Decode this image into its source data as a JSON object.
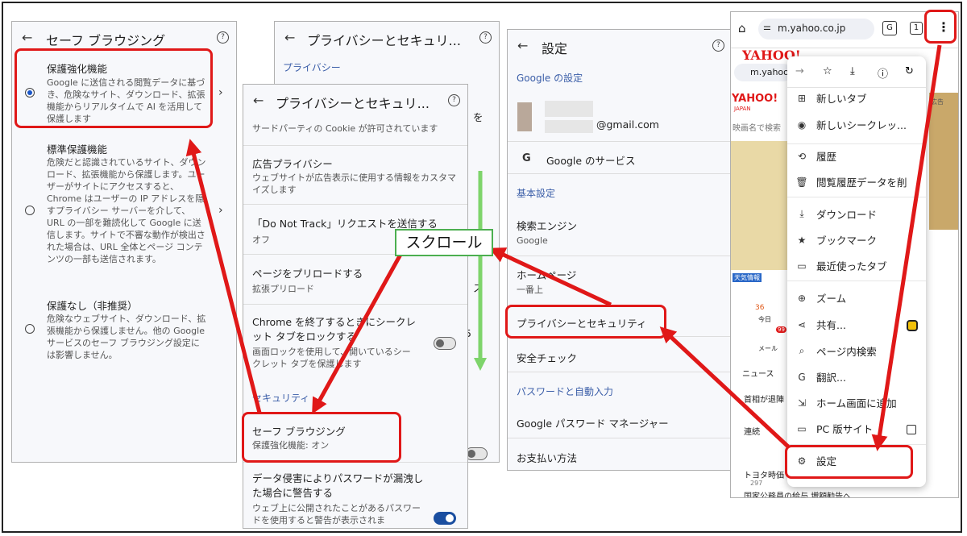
{
  "panel1": {
    "title": "セーフ ブラウジング",
    "options": [
      {
        "title": "保護強化機能",
        "desc": "Google に送信される閲覧データに基づき、危険なサイト、ダウンロード、拡張機能からリアルタイムで AI を活用して保護します"
      },
      {
        "title": "標準保護機能",
        "desc": "危険だと認識されているサイト、ダウンロード、拡張機能から保護します。ユーザーがサイトにアクセスすると、Chrome はユーザーの IP アドレスを隠すプライバシー サーバーを介して、URL の一部を難読化して Google に送信します。サイトで不審な動作が検出された場合は、URL 全体とページ コンテンツの一部も送信されます。"
      },
      {
        "title": "保護なし（非推奨）",
        "desc": "危険なウェブサイト、ダウンロード、拡張機能から保護しません。他の Google サービスのセーフ ブラウジング設定には影響しません。"
      }
    ]
  },
  "panel2": {
    "title": "プライバシーとセキュリ...",
    "section": "プライバシー",
    "frag1": "を",
    "frag2": "ス",
    "frag3": "5"
  },
  "panel3": {
    "title": "プライバシーとセキュリ...",
    "frag_cookie": "サードパーティの Cookie",
    "frag_cookie2": "サードパーティの Cookie が許可されています",
    "ad_title": "広告プライバシー",
    "ad_desc": "ウェブサイトが広告表示に使用する情報をカスタマイズします",
    "dnt_title": "「Do Not Track」リクエストを送信する",
    "dnt_value": "オフ",
    "preload_title": "ページをプリロードする",
    "preload_value": "拡張プリロード",
    "lock_title": "Chrome を終了するときにシークレット タブをロックする",
    "lock_desc": "画面ロックを使用して、開いているシークレット タブを保護します",
    "security_section": "セキュリティ",
    "sb_title": "セーフ ブラウジング",
    "sb_value": "保護強化機能: オン",
    "pw_title": "データ侵害によりパスワードが漏洩した場合に警告する",
    "pw_desc": "ウェブ上に公開されたことがあるパスワードを使用すると警告が表示されま"
  },
  "panel4": {
    "title": "設定",
    "google_section": "Google の設定",
    "email": "@gmail.com",
    "google_services": "Google のサービス",
    "basic_section": "基本設定",
    "search_engine": "検索エンジン",
    "search_engine_value": "Google",
    "homepage_title": "ホームページ",
    "homepage_value": "一番上",
    "privacy": "プライバシーとセキュリティ",
    "safety_check": "安全チェック",
    "pw_section": "パスワードと自動入力",
    "gpm": "Google パスワード マネージャー",
    "payment": "お支払い方法"
  },
  "browser": {
    "url": "m.yahoo.co.jp",
    "inner_url": "m.yahoo",
    "tab_count": "1",
    "logo": "YAHOO!",
    "logo_sub": "JAPAN",
    "search_ph": "映画名で検索",
    "ad_label": "広告",
    "news": "ニュース",
    "story1": "首相が退陣",
    "story2": "連続",
    "story3": "トヨタ時価",
    "story3_meta": "297",
    "bottom_news": "国家公務員の給与 増額勧告へ",
    "mail": "メール",
    "today": "今日",
    "weather": "天気情報",
    "temp": "36",
    "count": "99"
  },
  "menu": {
    "items": [
      {
        "icon": "⊞",
        "label": "新しいタブ"
      },
      {
        "icon": "◉",
        "label": "新しいシークレッ..."
      },
      {
        "icon": "⟲",
        "label": "履歴"
      },
      {
        "icon": "🗑",
        "label": "閲覧履歴データを削"
      },
      {
        "icon": "⤓",
        "label": "ダウンロード"
      },
      {
        "icon": "★",
        "label": "ブックマーク"
      },
      {
        "icon": "▭",
        "label": "最近使ったタブ"
      },
      {
        "icon": "⊕",
        "label": "ズーム"
      },
      {
        "icon": "⋖",
        "label": "共有..."
      },
      {
        "icon": "⌕",
        "label": "ページ内検索"
      },
      {
        "icon": "G",
        "label": "翻訳..."
      },
      {
        "icon": "⇲",
        "label": "ホーム画面に追加"
      },
      {
        "icon": "▭",
        "label": "PC 版サイト"
      },
      {
        "icon": "⚙",
        "label": "設定"
      }
    ]
  },
  "annotation": {
    "scroll": "スクロール"
  },
  "colors": {
    "highlight": "#e01818",
    "scroll_green": "#7ed46b",
    "link_blue": "#3b5ea8"
  }
}
